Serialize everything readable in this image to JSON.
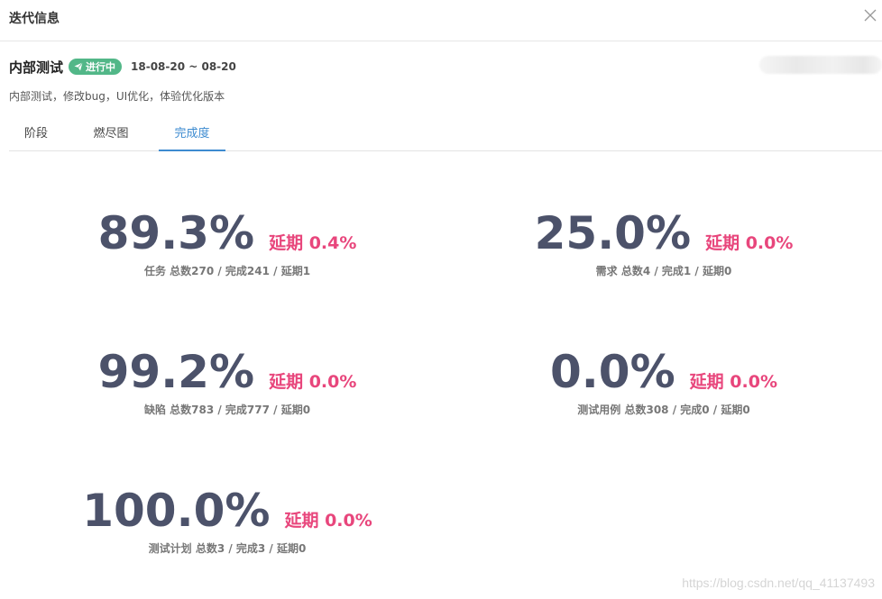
{
  "dialog": {
    "title": "迭代信息"
  },
  "iteration": {
    "name": "内部测试",
    "status": "进行中",
    "date_range": "18-08-20 ~ 08-20",
    "description": "内部测试，修改bug，UI优化，体验优化版本"
  },
  "tabs": [
    {
      "label": "阶段"
    },
    {
      "label": "燃尽图"
    },
    {
      "label": "完成度"
    }
  ],
  "stats": [
    {
      "percent": "89.3%",
      "delay": "延期 0.4%",
      "summary": "任务 总数270 / 完成241 / 延期1"
    },
    {
      "percent": "25.0%",
      "delay": "延期 0.0%",
      "summary": "需求 总数4 / 完成1 / 延期0"
    },
    {
      "percent": "99.2%",
      "delay": "延期 0.0%",
      "summary": "缺陷 总数783 / 完成777 / 延期0"
    },
    {
      "percent": "0.0%",
      "delay": "延期 0.0%",
      "summary": "测试用例 总数308 / 完成0 / 延期0"
    },
    {
      "percent": "100.0%",
      "delay": "延期 0.0%",
      "summary": "测试计划 总数3 / 完成3 / 延期0"
    }
  ],
  "watermark": "https://blog.csdn.net/qq_41137493",
  "colors": {
    "accent": "#3d8bd0",
    "status_green": "#52b788",
    "delay_pink": "#e8467c",
    "percent_slate": "#4c526a"
  },
  "icons": {
    "close": "close-icon",
    "status": "paper-plane-icon"
  }
}
